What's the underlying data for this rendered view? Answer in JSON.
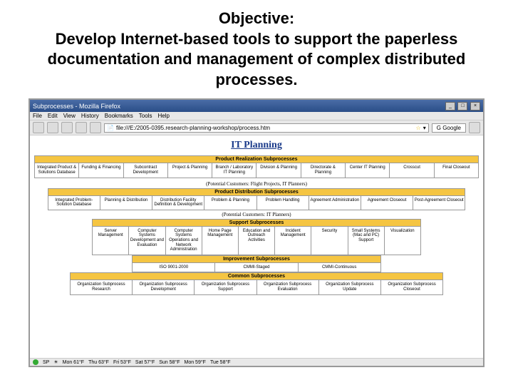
{
  "slide": {
    "title_line1": "Objective:",
    "title_line2": "Develop Internet-based tools to support the paperless documentation and management of complex distributed processes."
  },
  "browser": {
    "window_title": "Subprocesses - Mozilla Firefox",
    "menu": [
      "File",
      "Edit",
      "View",
      "History",
      "Bookmarks",
      "Tools",
      "Help"
    ],
    "url": "file:///E:/2005-0395.research-planning-workshop/process.htm",
    "search_placeholder": "Google",
    "page_title": "IT Planning"
  },
  "sections": [
    {
      "header": "Product Realization Subprocesses",
      "rows": [
        "Integrated Product & Solutions Database",
        "Funding & Financing",
        "Subcontract Development",
        "Project & Planning",
        "Branch / Laboratory IT Planning",
        "Division & Planning",
        "Directorate & Planning",
        "Center IT Planning",
        "Crosscut",
        "Final Closeout"
      ],
      "subtitle": "(Potential Customers: Flight Projects, IT Planners)",
      "wclass": "w100"
    },
    {
      "header": "Product Distribution Subprocesses",
      "rows": [
        "Integrated Problem-Solution Database",
        "Planning & Distribution",
        "Distribution Facility Definition & Development",
        "Problem & Planning",
        "Problem Handling",
        "Agreement Administration",
        "Agreement Closeout",
        "Post-Agreement Closeout"
      ],
      "subtitle": "(Potential Customers: IT Planners)",
      "wclass": "w90"
    },
    {
      "header": "Support Subprocesses",
      "rows": [
        "Server Management",
        "Computer Systems Development and Evaluation",
        "Computer Systems Operations and Network Administration",
        "Home Page Management",
        "Education and Outreach Activities",
        "Incident Management",
        "Security",
        "Small Systems (Mac and PC) Support",
        "Visualization"
      ],
      "subtitle": "",
      "wclass": "w70"
    },
    {
      "header": "Improvement Subprocesses",
      "rows": [
        "ISO 9001-2000",
        "CMMI-Staged",
        "CMMI-Continuous"
      ],
      "subtitle": "",
      "wclass": "w50"
    },
    {
      "header": "Common Subprocesses",
      "rows": [
        "Organization Subprocess Research",
        "Organization Subprocess Development",
        "Organization Subprocess Support",
        "Organization Subprocess Evaluation",
        "Organization Subprocess Update",
        "Organization Subprocess Closeout"
      ],
      "subtitle": "",
      "wclass": "w80"
    }
  ],
  "taskbar": [
    "Mon 61°F",
    "Thu 63°F",
    "Fri 53°F",
    "Sat 57°F",
    "Sun 58°F",
    "Mon 59°F",
    "Tue 58°F"
  ]
}
